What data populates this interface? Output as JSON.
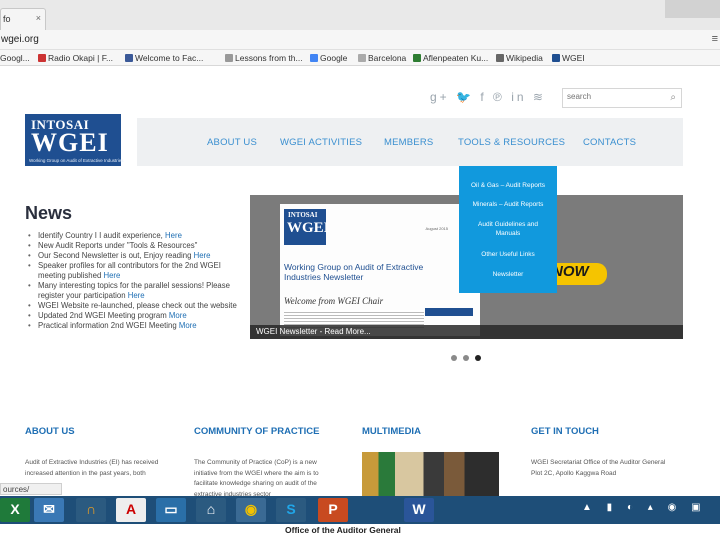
{
  "browser": {
    "tab_label": "fo",
    "url": "wgei.org",
    "bookmarks": [
      "Googl...",
      "Radio Okapi | F...",
      "Welcome to Fac...",
      "Lessons from th...",
      "Google",
      "Barcelona",
      "Aflenpeaten Ku...",
      "Wikipedia",
      "WGEI"
    ]
  },
  "header": {
    "social_icons": [
      "google-plus-icon",
      "twitter-icon",
      "facebook-icon",
      "pinterest-icon",
      "linkedin-icon",
      "rss-icon"
    ],
    "search_placeholder": "search",
    "logo_top": "INTOSAI",
    "logo_main": "WGEI",
    "logo_sub": "Working Group on Audit of Extractive Industries"
  },
  "nav": {
    "items": [
      "ABOUT US",
      "WGEI ACTIVITIES",
      "MEMBERS",
      "TOOLS & RESOURCES",
      "CONTACTS"
    ],
    "dropdown": [
      "Oil & Gas – Audit Reports",
      "Minerals – Audit Reports",
      "Audit Guidelines and Manuals",
      "Other Useful Links",
      "Newsletter"
    ]
  },
  "news": {
    "title": "News",
    "items": [
      {
        "text": "Identify Country I I audit experience,",
        "link": "Here"
      },
      {
        "text": "New Audit Reports under \"Tools & Resources\"",
        "link": ""
      },
      {
        "text": "Our Second Newsletter is out, Enjoy reading",
        "link": "Here"
      },
      {
        "text": "Speaker profiles for all contributors for the 2nd WGEI meeting published",
        "link": "Here"
      },
      {
        "text": "Many interesting topics for the parallel sessions! Please register your participation",
        "link": "Here"
      },
      {
        "text": "WGEI Website re-launched, please check out the website",
        "link": ""
      },
      {
        "text": "Updated 2nd WGEI Meeting program",
        "link": "More"
      },
      {
        "text": "Practical information 2nd WGEI Meeting",
        "link": "More"
      }
    ]
  },
  "slider": {
    "logo_top": "INTOSAI",
    "logo_main": "WGEI",
    "date": "August 2015",
    "paper_title": "Working Group on Audit of Extractive Industries Newsletter",
    "welcome": "Welcome from WGEI Chair",
    "now_text": "NOW",
    "caption": "WGEI Newsletter - Read More...",
    "slide_count": 3,
    "active_slide": 3
  },
  "sections": [
    {
      "heading": "ABOUT US",
      "text": "Audit of Extractive Industries (EI) has received increased attention in the past years, both"
    },
    {
      "heading": "COMMUNITY OF PRACTICE",
      "text": "The Community of Practice (CoP) is a new initiative from the WGEI where the aim is to facilitate knowledge sharing on audit of the extractive industries sector"
    },
    {
      "heading": "MULTIMEDIA",
      "text": ""
    },
    {
      "heading": "GET IN TOUCH",
      "text": "WGEI Secretariat Office of the Auditor General Plot 2C, Apollo Kaggwa Road"
    }
  ],
  "status_text": "ources/",
  "taskbar": {
    "apps": [
      "excel-icon",
      "mail-icon",
      "headphones-icon",
      "acrobat-icon",
      "monitor-icon",
      "home-icon",
      "chrome-icon",
      "skype-icon",
      "powerpoint-icon",
      "word-icon"
    ],
    "footer_label": "Office of the Auditor General"
  }
}
